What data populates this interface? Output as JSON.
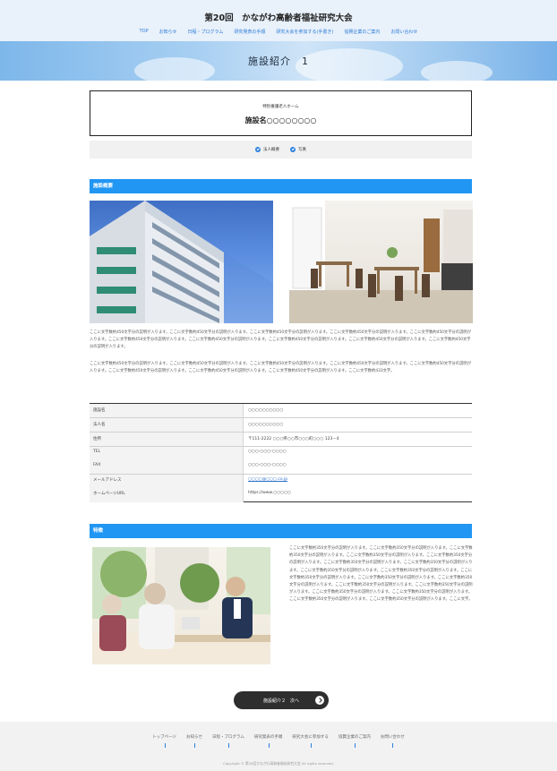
{
  "site": {
    "title": "第20回　かながわ高齢者福祉研究大会",
    "nav": [
      "TOP",
      "お知らせ",
      "日程・プログラム",
      "研究発表の手順",
      "研究大会を参加する(手書き)",
      "協賛企業のご案内",
      "お問い合わせ"
    ]
  },
  "hero": {
    "title": "施設紹介　1"
  },
  "facility": {
    "type": "特別養護老人ホーム",
    "name": "施設名○○○○○○○○",
    "tags": [
      "法人概要",
      "写真"
    ]
  },
  "sections": {
    "overview_heading": "施設概要",
    "features_heading": "特徴"
  },
  "overview": {
    "paragraphs": [
      "ここに文字数約450文字分の説明が入ります。ここに文字数約450文字分の説明が入ります。ここに文字数約450文字分の説明が入ります。ここに文字数約450文字分の説明が入ります。ここに文字数約450文字分の説明が入ります。ここに文字数約450文字分の説明が入ります。ここに文字数約450文字分の説明が入ります。ここに文字数約450文字分の説明が入ります。ここに文字数約450文字分の説明が入ります。ここに文字数約450文字分の説明が入ります。",
      "ここに文字数約450文字分の説明が入ります。ここに文字数約450文字分の説明が入ります。ここに文字数約450文字分の説明が入ります。ここに文字数約450文字分の説明が入ります。ここに文字数約450文字分の説明が入ります。ここに文字数約450文字分の説明が入ります。ここに文字数約450文字分の説明が入ります。ここに文字数約450文字分の説明が入ります。ここに文字数約433文字。"
    ]
  },
  "info": {
    "facility_label": "施設名",
    "facility_value": "○○○○○○○○○○",
    "corp_label": "法人名",
    "corp_value": "○○○○○○○○○○",
    "address_label": "住所",
    "address_value": "〒111-2222 ○○○県○○市○○○町○○○ 123－4",
    "tel_label": "TEL",
    "tel_value": "○○○-○○○-○○○○",
    "fax_label": "FAX",
    "fax_value": "○○○-○○○-○○○○",
    "email_label": "メールアドレス",
    "email_value": "○○○○@○○○.co.jp",
    "web_label": "ホームページURL",
    "web_value": "https://www.○○○○○"
  },
  "features": {
    "text": "ここに文字数約350文字分の説明が入ります。ここに文字数約350文字分の説明が入ります。ここに文字数約350文字分の説明が入ります。ここに文字数約350文字分の説明が入ります。ここに文字数約350文字分の説明が入ります。ここに文字数約350文字分の説明が入ります。ここに文字数約350文字分の説明が入ります。ここに文字数約350文字分の説明が入ります。ここに文字数約350文字分の説明が入ります。ここに文字数約350文字分の説明が入ります。ここに文字数約350文字分の説明が入ります。ここに文字数約350文字分の説明が入ります。ここに文字数約350文字分の説明が入ります。ここに文字数約350文字分の説明が入ります。ここに文字数約350文字分の説明が入ります。ここに文字数約350文字分の説明が入ります。ここに文字数約350文字分の説明が入ります。ここに文字数約350文字分の説明が入ります。ここに文字。"
  },
  "next_button": {
    "label": "施設紹介２　次へ"
  },
  "footer": {
    "nav": [
      "トップページ",
      "お知らせ",
      "日程・プログラム",
      "研究発表の手順",
      "研究大会に参加する",
      "協賛企業のご案内",
      "お問い合わせ"
    ],
    "copyright": "Copyright © 第20回かながわ高齢者福祉研究大会 All rights reserved."
  },
  "colors": {
    "accent": "#2196f3",
    "header_bg": "#e9f1fb",
    "button_bg": "#2e2e2e",
    "footer_bg": "#f2f2f2"
  }
}
